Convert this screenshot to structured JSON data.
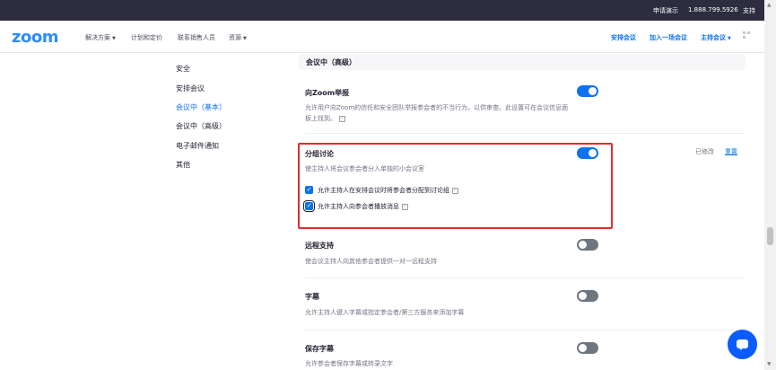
{
  "topbar": {
    "request_demo": "申请演示",
    "phone": "1.888.799.5926",
    "support": "支持"
  },
  "navbar": {
    "logo": "zoom",
    "items": [
      "解决方案",
      "计划和定价",
      "联系销售人员",
      "资源"
    ],
    "right": [
      "安排会议",
      "加入一场会议",
      "主持会议"
    ]
  },
  "sidenav": [
    "安全",
    "安排会议",
    "会议中（基本）",
    "会议中（高级）",
    "电子邮件通知",
    "其他"
  ],
  "section": {
    "title": "会议中（高级）"
  },
  "settings": {
    "report": {
      "title": "向Zoom举报",
      "desc": "允许用户向Zoom的信任和安全团队举报参会者的不当行为，以供审查。此设置可在会议信息面板上找到。",
      "enabled": true
    },
    "breakout": {
      "title": "分组讨论",
      "desc": "使主持人将会议参会者分入单独的小会议室",
      "enabled": true,
      "option1": "允许主持人在安排会议时将参会者分配到讨论组",
      "option2": "允许主持人向参会者播放消息",
      "modified": "已修改",
      "reset": "重置"
    },
    "remote_support": {
      "title": "远程支持",
      "desc": "使会议主持人向其他参会者提供一对一远程支持",
      "enabled": false
    },
    "captions": {
      "title": "字幕",
      "desc": "允许主持人键入字幕或指定参会者/第三方服务来添加字幕",
      "enabled": false
    },
    "save_captions": {
      "title": "保存字幕",
      "desc": "允许参会者保存字幕或转录文字",
      "enabled": false
    }
  },
  "colors": {
    "accent": "#0e72ed",
    "highlight": "#e52b2b",
    "topbar": "#2d2d3f"
  }
}
